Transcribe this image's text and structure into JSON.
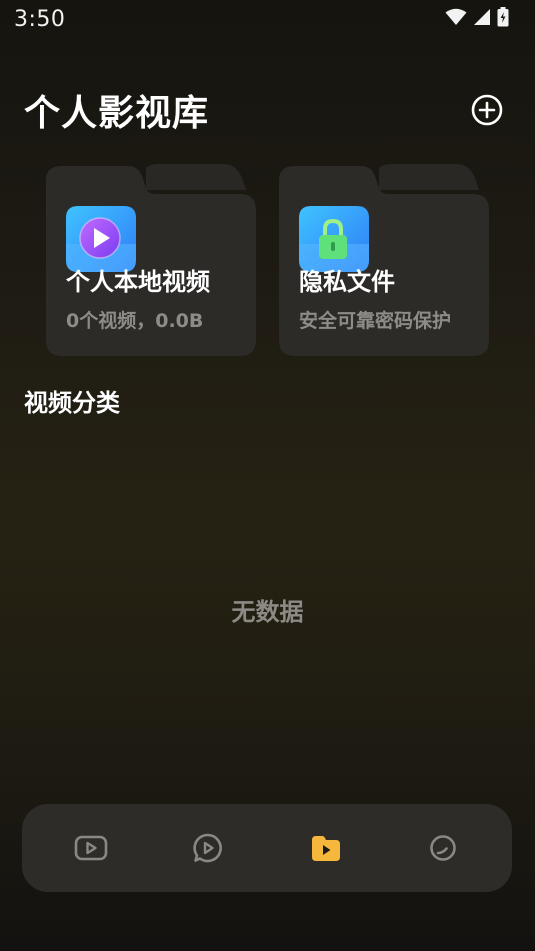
{
  "status_bar": {
    "time": "3:50"
  },
  "header": {
    "title": "个人影视库"
  },
  "cards": [
    {
      "title": "个人本地视频",
      "subtitle": "0个视频，0.0B",
      "icon": "play-folder-icon"
    },
    {
      "title": "隐私文件",
      "subtitle": "安全可靠密码保护",
      "icon": "lock-folder-icon"
    }
  ],
  "section": {
    "title": "视频分类"
  },
  "empty_state": {
    "text": "无数据"
  },
  "bottom_nav": {
    "items": [
      {
        "icon": "video-tab-icon",
        "active": false
      },
      {
        "icon": "play-chat-tab-icon",
        "active": false
      },
      {
        "icon": "folder-play-tab-icon",
        "active": true
      },
      {
        "icon": "circle-tab-icon",
        "active": false
      }
    ]
  },
  "colors": {
    "accent": "#f6b83c",
    "card_bg": "#2d2b28",
    "nav_bg": "#2e2c28",
    "muted_text": "#8e8c87"
  }
}
